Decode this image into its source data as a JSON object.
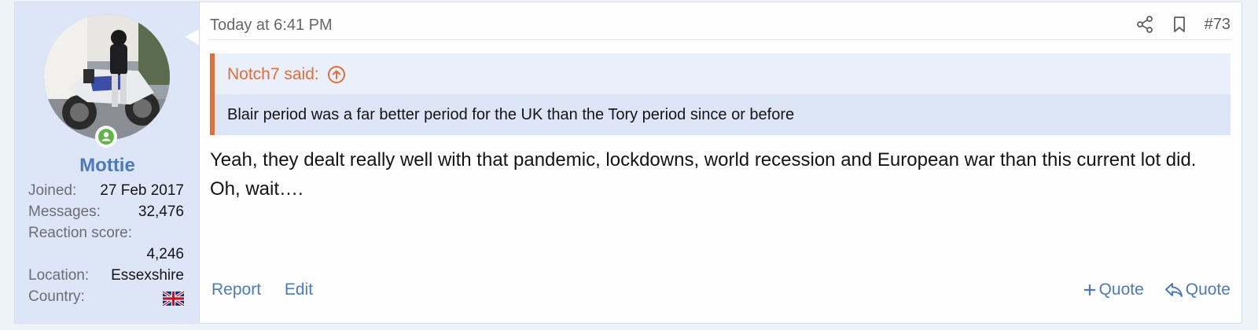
{
  "post": {
    "date": "Today at 6:41 PM",
    "post_number": "#73",
    "user": {
      "name": "Mottie",
      "stats": [
        {
          "label": "Joined:",
          "value": "27 Feb 2017"
        },
        {
          "label": "Messages:",
          "value": "32,476"
        },
        {
          "label": "Reaction score:",
          "value": ""
        },
        {
          "label": "",
          "value": "4,246"
        },
        {
          "label": "Location:",
          "value": "Essexshire"
        },
        {
          "label": "Country:",
          "value": ""
        }
      ],
      "country_flag": "uk-flag"
    },
    "quote": {
      "author_line": "Notch7 said:",
      "text": "Blair period was a far better period for the UK than the Tory period since or before"
    },
    "message": "Yeah, they dealt really well with that pandemic, lockdowns, world recession and European war than this current lot did. Oh, wait….",
    "footer": {
      "report": "Report",
      "edit": "Edit",
      "multi_quote": "Quote",
      "reply_quote": "Quote"
    },
    "icons": {
      "share": "share-icon",
      "bookmark": "bookmark-icon",
      "online": "online-status-icon",
      "jump": "arrow-up-circle-icon"
    },
    "colors": {
      "accent": "#4e79b8",
      "quote_accent": "#e0703a",
      "online": "#63b54a",
      "user_panel": "#dce6f7"
    }
  }
}
